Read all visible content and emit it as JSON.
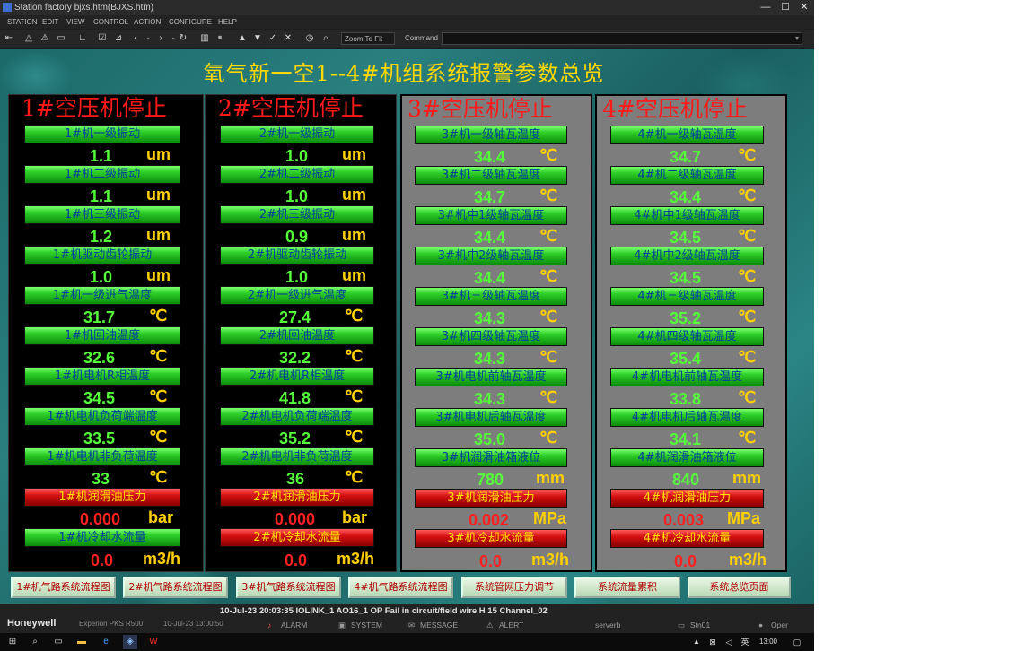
{
  "window": {
    "title": "Station   factory   bjxs.htm(BJXS.htm)",
    "controls": [
      "—",
      "☐",
      "✕"
    ]
  },
  "menu": [
    "STATION",
    "EDIT",
    "VIEW",
    "CONTROL",
    "ACTION",
    "CONFIGURE",
    "HELP"
  ],
  "toolbar": {
    "zoom_label": "Zoom To Fit",
    "command_label": "Command",
    "command_value": ""
  },
  "display": {
    "title": "氧气新一空1--4#机组系统报警参数总览",
    "panels": [
      {
        "title": "1#空压机停止",
        "rows": [
          {
            "label": "1#机一级振动",
            "value": "1.1",
            "unit": "um",
            "style": "g"
          },
          {
            "label": "1#机二级振动",
            "value": "1.1",
            "unit": "um",
            "style": "g"
          },
          {
            "label": "1#机三级振动",
            "value": "1.2",
            "unit": "um",
            "style": "g"
          },
          {
            "label": "1#机驱动齿轮振动",
            "value": "1.0",
            "unit": "um",
            "style": "g"
          },
          {
            "label": "1#机一级进气温度",
            "value": "31.7",
            "unit": "℃",
            "style": "g"
          },
          {
            "label": "1#机回油温度",
            "value": "32.6",
            "unit": "℃",
            "style": "g"
          },
          {
            "label": "1#机电机R相温度",
            "value": "34.5",
            "unit": "℃",
            "style": "g"
          },
          {
            "label": "1#机电机负荷端温度",
            "value": "33.5",
            "unit": "℃",
            "style": "g"
          },
          {
            "label": "1#机电机非负荷温度",
            "value": "33",
            "unit": "℃",
            "style": "g"
          },
          {
            "label": "1#机润滑油压力",
            "value": "0.000",
            "unit": "bar",
            "style": "r"
          },
          {
            "label": "1#机冷却水流量",
            "value": "0.0",
            "unit": "m3/h",
            "style": "g"
          }
        ]
      },
      {
        "title": "2#空压机停止",
        "rows": [
          {
            "label": "2#机一级振动",
            "value": "1.0",
            "unit": "um",
            "style": "g"
          },
          {
            "label": "2#机二级振动",
            "value": "1.0",
            "unit": "um",
            "style": "g"
          },
          {
            "label": "2#机三级振动",
            "value": "0.9",
            "unit": "um",
            "style": "g"
          },
          {
            "label": "2#机驱动齿轮振动",
            "value": "1.0",
            "unit": "um",
            "style": "g"
          },
          {
            "label": "2#机一级进气温度",
            "value": "27.4",
            "unit": "℃",
            "style": "g"
          },
          {
            "label": "2#机回油温度",
            "value": "32.2",
            "unit": "℃",
            "style": "g"
          },
          {
            "label": "2#机电机R相温度",
            "value": "41.8",
            "unit": "℃",
            "style": "g"
          },
          {
            "label": "2#机电机负荷端温度",
            "value": "35.2",
            "unit": "℃",
            "style": "g"
          },
          {
            "label": "2#机电机非负荷温度",
            "value": "36",
            "unit": "℃",
            "style": "g"
          },
          {
            "label": "2#机润滑油压力",
            "value": "0.000",
            "unit": "bar",
            "style": "r"
          },
          {
            "label": "2#机冷却水流量",
            "value": "0.0",
            "unit": "m3/h",
            "style": "r"
          }
        ]
      },
      {
        "title": "3#空压机停止",
        "rows": [
          {
            "label": "3#机一级轴瓦温度",
            "value": "34.4",
            "unit": "℃",
            "style": "g"
          },
          {
            "label": "3#机二级轴瓦温度",
            "value": "34.7",
            "unit": "℃",
            "style": "g"
          },
          {
            "label": "3#机中1级轴瓦温度",
            "value": "34.4",
            "unit": "℃",
            "style": "g"
          },
          {
            "label": "3#机中2级轴瓦温度",
            "value": "34.4",
            "unit": "℃",
            "style": "g"
          },
          {
            "label": "3#机三级轴瓦温度",
            "value": "34.3",
            "unit": "℃",
            "style": "g"
          },
          {
            "label": "3#机四级轴瓦温度",
            "value": "34.3",
            "unit": "℃",
            "style": "g"
          },
          {
            "label": "3#机电机前轴瓦温度",
            "value": "34.3",
            "unit": "℃",
            "style": "g"
          },
          {
            "label": "3#机电机后轴瓦温度",
            "value": "35.0",
            "unit": "℃",
            "style": "g"
          },
          {
            "label": "3#机润滑油箱液位",
            "value": "780",
            "unit": "mm",
            "style": "g"
          },
          {
            "label": "3#机润滑油压力",
            "value": "0.002",
            "unit": "MPa",
            "style": "r"
          },
          {
            "label": "3#机冷却水流量",
            "value": "0.0",
            "unit": "m3/h",
            "style": "r"
          }
        ]
      },
      {
        "title": "4#空压机停止",
        "rows": [
          {
            "label": "4#机一级轴瓦温度",
            "value": "34.7",
            "unit": "℃",
            "style": "g"
          },
          {
            "label": "4#机二级轴瓦温度",
            "value": "34.4",
            "unit": "℃",
            "style": "g"
          },
          {
            "label": "4#机中1级轴瓦温度",
            "value": "34.5",
            "unit": "℃",
            "style": "g"
          },
          {
            "label": "4#机中2级轴瓦温度",
            "value": "34.5",
            "unit": "℃",
            "style": "g"
          },
          {
            "label": "4#机三级轴瓦温度",
            "value": "35.2",
            "unit": "℃",
            "style": "g"
          },
          {
            "label": "4#机四级轴瓦温度",
            "value": "35.4",
            "unit": "℃",
            "style": "g"
          },
          {
            "label": "4#机电机前轴瓦温度",
            "value": "33.8",
            "unit": "℃",
            "style": "g"
          },
          {
            "label": "4#机电机后轴瓦温度",
            "value": "34.1",
            "unit": "℃",
            "style": "g"
          },
          {
            "label": "4#机润滑油箱液位",
            "value": "840",
            "unit": "mm",
            "style": "g"
          },
          {
            "label": "4#机润滑油压力",
            "value": "0.003",
            "unit": "MPa",
            "style": "r"
          },
          {
            "label": "4#机冷却水流量",
            "value": "0.0",
            "unit": "m3/h",
            "style": "r"
          }
        ]
      }
    ],
    "nav_buttons": [
      "1#机气路系统流程图",
      "2#机气路系统流程图",
      "3#机气路系统流程图",
      "4#机气路系统流程图",
      "系统管网压力调节",
      "系统流量累积",
      "系统总览页面"
    ]
  },
  "status": {
    "brand": "Honeywell",
    "product": "Experion PKS R500",
    "time_small": "10-Jul-23  13:00:50",
    "message": "10-Jul-23   20:03:35   IOLINK_1   AO16_1   OP Fail in circuit/field wire  H 15 Channel_02",
    "items": [
      "ALARM",
      "SYSTEM",
      "MESSAGE",
      "ALERT",
      "serverb",
      "Stn01",
      "Oper"
    ]
  },
  "taskbar": {
    "clock": "13:00",
    "lang": "英"
  }
}
